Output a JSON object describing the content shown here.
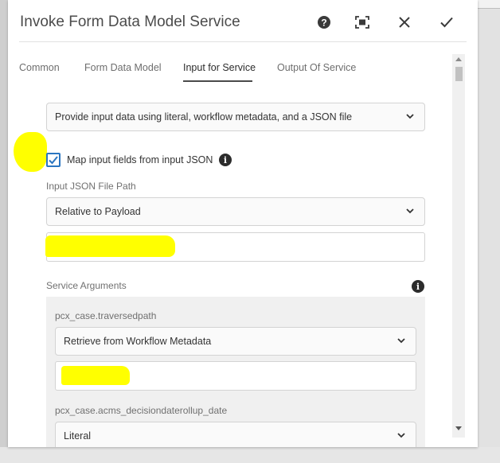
{
  "dialog": {
    "title": "Invoke Form Data Model Service",
    "help_icon": "help-icon",
    "fullscreen_icon": "fullscreen-icon",
    "close_icon": "close-icon",
    "done_icon": "checkmark-icon"
  },
  "tabs": [
    {
      "label": "Common",
      "active": false
    },
    {
      "label": "Form Data Model",
      "active": false
    },
    {
      "label": "Input for Service",
      "active": true
    },
    {
      "label": "Output Of Service",
      "active": false
    }
  ],
  "input_mode_select": {
    "value": "Provide input data using literal, workflow metadata, and a JSON file"
  },
  "map_checkbox": {
    "label": "Map input fields from input JSON",
    "checked": true
  },
  "json_path": {
    "label": "Input JSON File Path",
    "select_value": "Relative to Payload",
    "input_value": ""
  },
  "service_arguments": {
    "label": "Service Arguments",
    "args": [
      {
        "name": "pcx_case.traversedpath",
        "select_value": "Retrieve from Workflow Metadata",
        "input_value": ""
      },
      {
        "name": "pcx_case.acms_decisiondaterollup_date",
        "select_value": "Literal"
      }
    ]
  },
  "colors": {
    "accent": "#2b76c1",
    "highlight": "#ffff00"
  }
}
